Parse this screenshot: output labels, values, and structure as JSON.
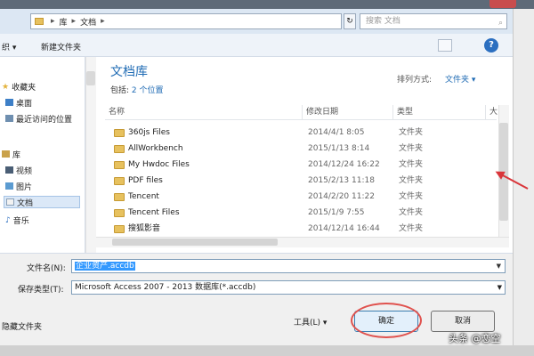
{
  "address": {
    "segments": [
      "库",
      "文档"
    ],
    "search_placeholder": "搜索 文档"
  },
  "toolbar": {
    "organize": "织 ▾",
    "new_folder": "新建文件夹"
  },
  "nav": {
    "items": [
      {
        "label": "收藏夹"
      },
      {
        "label": "桌面"
      },
      {
        "label": "最近访问的位置"
      },
      {
        "label": "库"
      },
      {
        "label": "视频"
      },
      {
        "label": "图片"
      },
      {
        "label": "文档"
      },
      {
        "label": "音乐"
      }
    ]
  },
  "library": {
    "title": "文档库",
    "includes_label": "包括:",
    "includes_link": "2 个位置",
    "sort_label": "排列方式:",
    "sort_value": "文件夹 ▾"
  },
  "columns": {
    "name": "名称",
    "date": "修改日期",
    "type": "类型",
    "size": "大"
  },
  "files": [
    {
      "name": "360js Files",
      "date": "2014/4/1 8:05",
      "type": "文件夹"
    },
    {
      "name": "AllWorkbench",
      "date": "2015/1/13 8:14",
      "type": "文件夹"
    },
    {
      "name": "My Hwdoc Files",
      "date": "2014/12/24 16:22",
      "type": "文件夹"
    },
    {
      "name": "PDF files",
      "date": "2015/2/13 11:18",
      "type": "文件夹"
    },
    {
      "name": "Tencent",
      "date": "2014/2/20 11:22",
      "type": "文件夹"
    },
    {
      "name": "Tencent Files",
      "date": "2015/1/9 7:55",
      "type": "文件夹"
    },
    {
      "name": "搜狐影音",
      "date": "2014/12/14 16:44",
      "type": "文件夹"
    }
  ],
  "form": {
    "filename_label": "文件名(N):",
    "filename_value": "企业资产.accdb",
    "type_label": "保存类型(T):",
    "type_value": "Microsoft Access 2007 - 2013 数据库(*.accdb)",
    "hide_folders": "隐藏文件夹",
    "tools": "工具(L)  ▾",
    "ok": "确定",
    "cancel": "取消"
  },
  "watermark": "头条 @恋空",
  "colors": {
    "accent": "#1f6bb4",
    "annotation": "#e0524e",
    "selection": "#3399ff"
  }
}
